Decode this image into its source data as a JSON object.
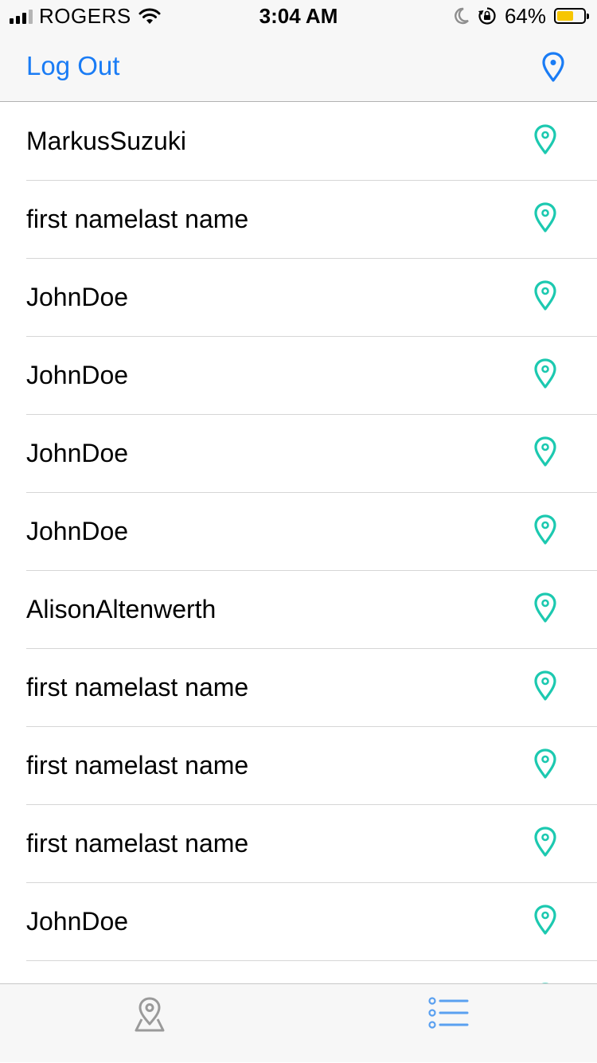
{
  "status_bar": {
    "carrier": "ROGERS",
    "time": "3:04 AM",
    "battery_percent_label": "64%",
    "battery_level": 0.64,
    "signal_bars_active": 3,
    "signal_bars_total": 4,
    "icons": [
      "signal-icon",
      "wifi-icon",
      "moon-icon",
      "orientation-lock-icon",
      "battery-icon"
    ]
  },
  "nav_bar": {
    "logout_label": "Log Out",
    "right_icon": "location-pin-icon"
  },
  "list": {
    "rows": [
      {
        "label": "MarkusSuzuki",
        "icon": "location-pin-icon"
      },
      {
        "label": "first namelast name",
        "icon": "location-pin-icon"
      },
      {
        "label": "JohnDoe",
        "icon": "location-pin-icon"
      },
      {
        "label": "JohnDoe",
        "icon": "location-pin-icon"
      },
      {
        "label": "JohnDoe",
        "icon": "location-pin-icon"
      },
      {
        "label": "JohnDoe",
        "icon": "location-pin-icon"
      },
      {
        "label": "AlisonAltenwerth",
        "icon": "location-pin-icon"
      },
      {
        "label": "first namelast name",
        "icon": "location-pin-icon"
      },
      {
        "label": "first namelast name",
        "icon": "location-pin-icon"
      },
      {
        "label": "first namelast name",
        "icon": "location-pin-icon"
      },
      {
        "label": "JohnDoe",
        "icon": "location-pin-icon"
      },
      {
        "label": "",
        "icon": "location-pin-icon"
      }
    ]
  },
  "tab_bar": {
    "tabs": [
      {
        "icon": "map-pin-icon",
        "selected": false
      },
      {
        "icon": "list-icon",
        "selected": true
      }
    ]
  },
  "colors": {
    "accent_blue": "#1a7cf5",
    "pin_teal": "#1cc9b0",
    "battery_yellow": "#f7c600",
    "tab_inactive": "#9a9a9a",
    "tab_active": "#5aa0f0"
  }
}
